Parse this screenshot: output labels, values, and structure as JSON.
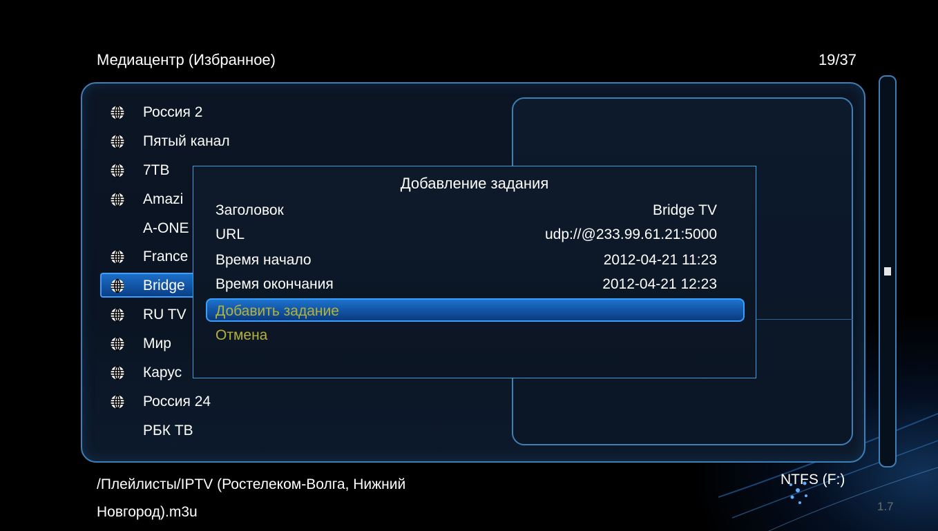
{
  "header": {
    "title": "Медиацентр (Избранное)",
    "counter": "19/37"
  },
  "channels": [
    {
      "name": "Россия 2",
      "icon": "globe-icon"
    },
    {
      "name": "Пятый канал",
      "icon": "globe-icon"
    },
    {
      "name": "7ТВ",
      "icon": "globe-icon"
    },
    {
      "name": "Amazi",
      "icon": "globe-icon"
    },
    {
      "name": "A-ONE",
      "icon": ""
    },
    {
      "name": "France",
      "icon": "globe-icon"
    },
    {
      "name": "Bridge",
      "icon": "globe-icon",
      "selected": true
    },
    {
      "name": "RU TV",
      "icon": "globe-icon"
    },
    {
      "name": "Мир",
      "icon": "globe-icon"
    },
    {
      "name": "Карус",
      "icon": "globe-icon"
    },
    {
      "name": "Россия 24",
      "icon": "globe-icon"
    },
    {
      "name": "РБК ТВ",
      "icon": ""
    }
  ],
  "footer": {
    "path_line1": "/Плейлисты/IPTV (Ростелеком-Волга, Нижний",
    "path_line2": "Новгород).m3u",
    "drive": "NTFS (F:)",
    "version": "1.7"
  },
  "scroll": {
    "position": 19,
    "total": 37
  },
  "dialog": {
    "title": "Добавление задания",
    "fields": [
      {
        "label": "Заголовок",
        "value": "Bridge TV"
      },
      {
        "label": "URL",
        "value": "udp://@233.99.61.21:5000"
      },
      {
        "label": "Время начало",
        "value": "2012-04-21 11:23"
      },
      {
        "label": "Время окончания",
        "value": "2012-04-21 12:23"
      }
    ],
    "add_label": "Добавить задание",
    "cancel_label": "Отмена"
  },
  "colors": {
    "accent": "#3aa0ff",
    "panel_border": "#3e7fb5",
    "action_text": "#b5b23a"
  }
}
